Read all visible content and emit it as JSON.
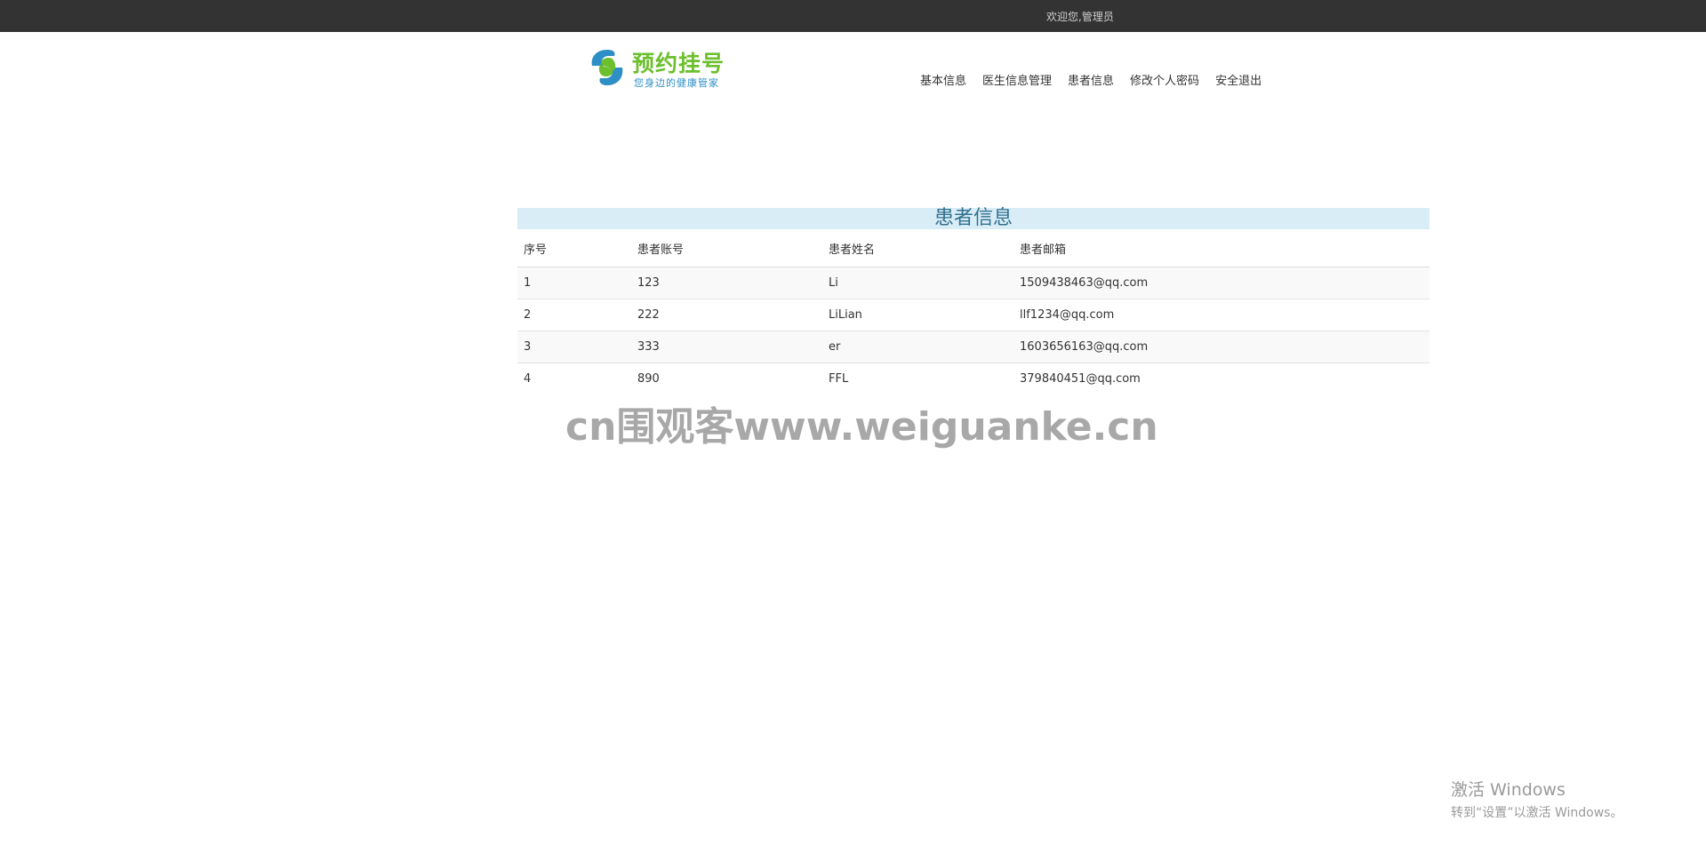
{
  "topbar": {
    "welcome": "欢迎您,管理员"
  },
  "logo": {
    "title": "预约挂号",
    "slogan": "您身边的健康管家"
  },
  "nav": [
    "基本信息",
    "医生信息管理",
    "患者信息",
    "修改个人密码",
    "安全退出"
  ],
  "panel": {
    "title": "患者信息",
    "columns": [
      "序号",
      "患者账号",
      "患者姓名",
      "患者邮箱"
    ],
    "rows": [
      [
        "1",
        "123",
        "Li",
        "1509438463@qq.com"
      ],
      [
        "2",
        "222",
        "LiLian",
        "llf1234@qq.com"
      ],
      [
        "3",
        "333",
        "er",
        "1603656163@qq.com"
      ],
      [
        "4",
        "890",
        "FFL",
        "379840451@qq.com"
      ]
    ]
  },
  "watermark": "cn围观客www.weiguanke.cn",
  "windows_activation": {
    "title": "激活 Windows",
    "subtitle": "转到“设置”以激活 Windows。"
  },
  "colors": {
    "topbar": "#333333",
    "title_bg": "#d9edf7",
    "title_text": "#31708f",
    "logo_green": "#6cbf2d",
    "logo_blue": "#2e8fc7"
  }
}
